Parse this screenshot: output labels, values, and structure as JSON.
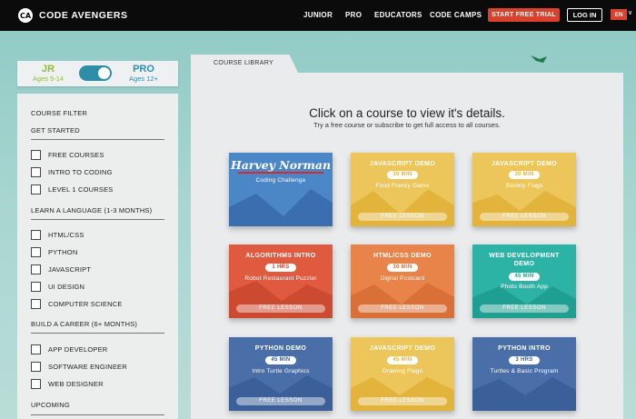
{
  "header": {
    "logo_mark": "CA",
    "logo_text": "CODE AVENGERS",
    "nav": [
      "JUNIOR",
      "PRO",
      "EDUCATORS",
      "CODE CAMPS"
    ],
    "trial_label": "START FREE TRIAL",
    "login_label": "LOG IN",
    "language": "EN"
  },
  "toggle": {
    "jr_label": "JR",
    "jr_ages": "Ages 5-14",
    "pro_label": "PRO",
    "pro_ages": "Ages 12+",
    "selected": "PRO"
  },
  "filter": {
    "title": "COURSE FILTER",
    "sections": [
      {
        "heading": "GET STARTED",
        "items": [
          "FREE COURSES",
          "INTRO TO CODING",
          "LEVEL 1 COURSES"
        ]
      },
      {
        "heading": "LEARN A LANGUAGE (1-3 MONTHS)",
        "items": [
          "HTML/CSS",
          "PYTHON",
          "JAVASCRIPT",
          "UI DESIGN",
          "COMPUTER SCIENCE"
        ]
      },
      {
        "heading": "BUILD A CAREER (6+ MONTHS)",
        "items": [
          "APP DEVELOPER",
          "SOFTWARE ENGINEER",
          "WEB DESIGNER"
        ]
      },
      {
        "heading": "UPCOMING",
        "items": []
      }
    ]
  },
  "library": {
    "tab_label": "COURSE LIBRARY",
    "headline": "Click on a course to view it's details.",
    "subline": "Try a free course or subscribe to get full access to all courses.",
    "cards": [
      {
        "logo": "Harvey Norman",
        "name": "Coding Challenge",
        "color": "#4b86c7",
        "color2": "#3a6eaf"
      },
      {
        "title": "JAVASCRIPT DEMO",
        "duration": "30 MIN",
        "name": "Food Frenzy Game",
        "free": "FREE LESSON",
        "color": "#ecc65a",
        "color2": "#e2b43c"
      },
      {
        "title": "JAVASCRIPT DEMO",
        "duration": "30 MIN",
        "name": "Blockly Flags",
        "free": "FREE LESSON",
        "color": "#ecc65a",
        "color2": "#e2b43c"
      },
      {
        "title": "ALGORITHMS INTRO",
        "duration": "1 HRS",
        "name": "Robot Restaurant Puzzler",
        "free": "FREE LESSON",
        "color": "#df5a3f",
        "color2": "#cc4a30"
      },
      {
        "title": "HTML/CSS DEMO",
        "duration": "30 MIN",
        "name": "Digital Postcard",
        "free": "FREE LESSON",
        "color": "#e8834a",
        "color2": "#d97038"
      },
      {
        "title": "WEB DEVELOPMENT DEMO",
        "duration": "45 MIN",
        "name": "Photo Booth App",
        "free": "FREE LESSON",
        "color": "#2db3a6",
        "color2": "#1f9e92"
      },
      {
        "title": "PYTHON DEMO",
        "duration": "45 MIN",
        "name": "Intro Turtle Graphics",
        "free": "FREE LESSON",
        "color": "#4a6fa8",
        "color2": "#3b5f98"
      },
      {
        "title": "JAVASCRIPT DEMO",
        "duration": "45 MIN",
        "name": "Drawing Flags",
        "free": "FREE LESSON",
        "color": "#ecc65a",
        "color2": "#e2b43c"
      },
      {
        "title": "PYTHON INTRO",
        "duration": "3 HRS",
        "name": "Turtles & Basic Program",
        "free": "",
        "color": "#4a6fa8",
        "color2": "#3b5f98"
      }
    ]
  }
}
